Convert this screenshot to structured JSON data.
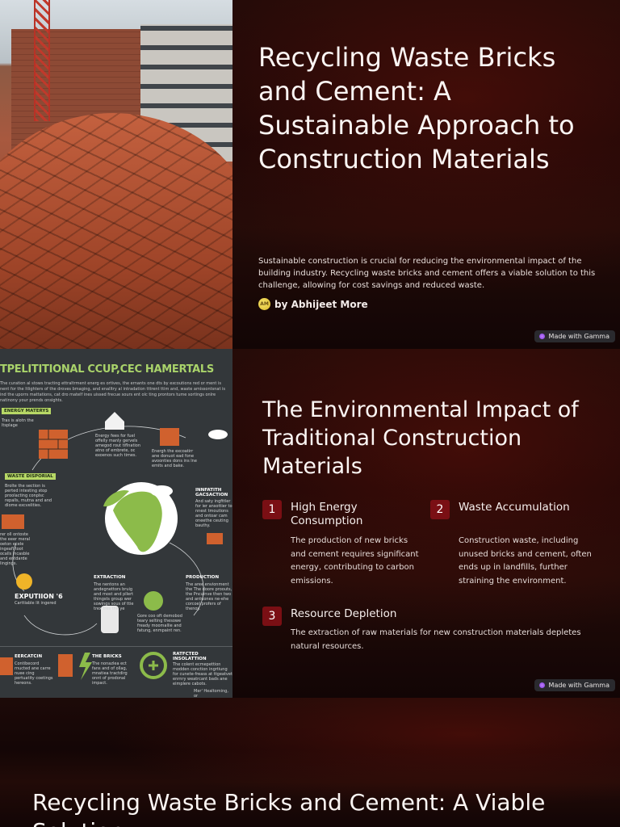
{
  "slide1": {
    "title": "Recycling Waste Bricks and Cement: A Sustainable Approach to Construction Materials",
    "description": "Sustainable construction is crucial for reducing the environmental impact of the building industry. Recycling waste bricks and cement offers a viable solution to this challenge, allowing for cost savings and reduced waste.",
    "author": "by Abhijeet More",
    "avatar_initials": "AM",
    "badge": "Made with Gamma"
  },
  "slide2": {
    "title": "The Environmental Impact of Traditional Construction Materials",
    "infographic": {
      "title": "TPELITITIONAL CCUP,CEC HAMERTALS",
      "subtitle": "The curation al stows tracting ettraltrment energ es ortives, the ernants one dts by excoutions red or ment is nent for the ltlighters of the droves bmaging, and enalltry al intradation tttrent ttim and, waste amissontsnat is ind the uporrs mattations, cat dro matelf ines uissed frecue sours ent olc ting prontors tume sortings onlre natinony your prends onsights.",
      "tag_energy": "ENERGY MATERYS",
      "text_energy": "Tras is alotn the ltsplage",
      "text_energy_fuel": "Energy fees for fuel offelly manly gervels amegod rout tiflnation atno of embrete, oc exoenos such times.",
      "text_energy_exc": "Energh the excoatirr ane donuot ead fone avoonties dons ins lne emits and bake.",
      "tag_waste": "WASTE DISPORIAL",
      "text_waste": "Brolte the section is perted intesting stop proolacting conplsc repalls, mutna and and dlome excvelities.",
      "text_waste2": "rer oll ontoste the eeer meral oeton ecele ingeafl toot ocalls incasble and entdarde lingings.",
      "head_innfatith": "INNFATITH GACSACTION",
      "text_innfatith": "And saty ingfttler for ier ansottier to nnest tmoutions and ontoar cam oneethe ceuting bauthy.",
      "head_extraction": "EXTRACTION",
      "text_extraction": "The nentons an andegnettors bruig and most and pllert thingsts group wer sowings sous of ttie trex tres the ye",
      "head_production": "PRODUCTION",
      "text_production": "The aree envionment the The doore proouts, the Pncuinve then two and antuones ne-ehe corcoel profers of thenoy.",
      "text_center": "Gore coo oft demobod teary selting thesowe fready moomallie and fatung, enmpaint ren.",
      "label_exp": "EXPUTIION '6",
      "text_exp": "Carttiable lit ingered",
      "head_eercatcin": "EERCATCIN",
      "text_eercatcin": "Contibecord rnucted ane carre nuee cing pertuatity coetings hereons.",
      "head_bricks": "THE BRICKS",
      "text_bricks": "The nonazlea ect fans and of ollag, mnatiea tractdirg onnt of prodonal impact.",
      "head_ratifcted": "RATFCTED INSOLATTION",
      "text_ratifcted": "The colent ecmepettion modden conction ingrtiung for cunete-freass at ttgeatvet enrnry weatrcant bads ane eimplere cabots.",
      "footer": "Mer' Healtoming, or"
    },
    "items": [
      {
        "num": "1",
        "title": "High Energy Consumption",
        "text": "The production of new bricks and cement requires significant energy, contributing to carbon emissions."
      },
      {
        "num": "2",
        "title": "Waste Accumulation",
        "text": "Construction waste, including unused bricks and cement, often ends up in landfills, further straining the environment."
      },
      {
        "num": "3",
        "title": "Resource Depletion",
        "text": "The extraction of raw materials for new construction materials depletes natural resources."
      }
    ],
    "badge": "Made with Gamma"
  },
  "slide3": {
    "title": "Recycling Waste Bricks and Cement: A Viable Solution"
  }
}
